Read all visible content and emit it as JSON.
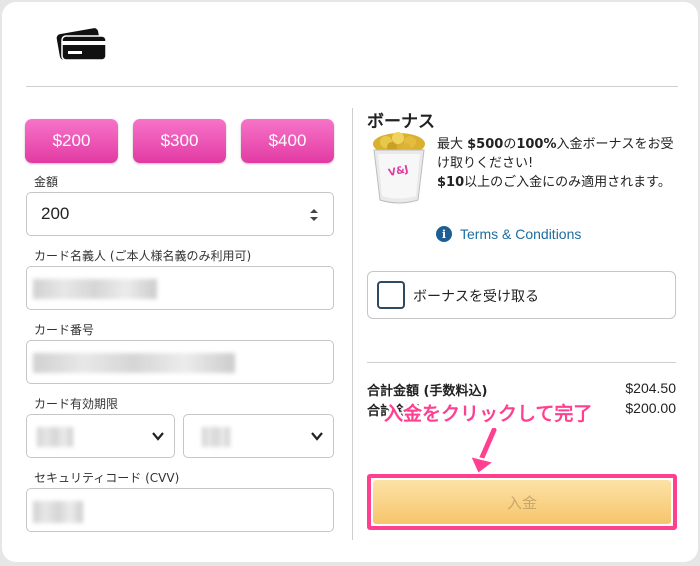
{
  "header": {
    "icon": "credit-card-icon"
  },
  "quick_amounts": [
    "$200",
    "$300",
    "$400"
  ],
  "form": {
    "amount_label": "金額",
    "amount_value": "200",
    "cardholder_label": "カード名義人 (ご本人様名義のみ利用可)",
    "card_number_label": "カード番号",
    "expiry_label": "カード有効期限",
    "cvv_label": "セキュリティコード (CVV)"
  },
  "bonus": {
    "title": "ボーナス",
    "line1_prefix": "最大 ",
    "line1_amount": "$500",
    "line1_mid": "の",
    "line1_percent": "100%",
    "line1_suffix": "入金ボーナスをお受け取りください!",
    "line2_amount": "$10",
    "line2_suffix": "以上のご入金にのみ適用されます。",
    "terms_label": "Terms & Conditions",
    "accept_label": "ボーナスを受け取る"
  },
  "summary": {
    "total_label": "合計金額 (手数料込)",
    "total_value": "$204.50",
    "sub_label": "合計金額",
    "sub_value": "$200.00"
  },
  "annotation": "入金をクリックして完了",
  "deposit_label": "入金",
  "colors": {
    "accent": "#e23aa3",
    "annotation": "#ff3f8f",
    "link": "#1d6d9e",
    "deposit": "#f6c56c"
  }
}
